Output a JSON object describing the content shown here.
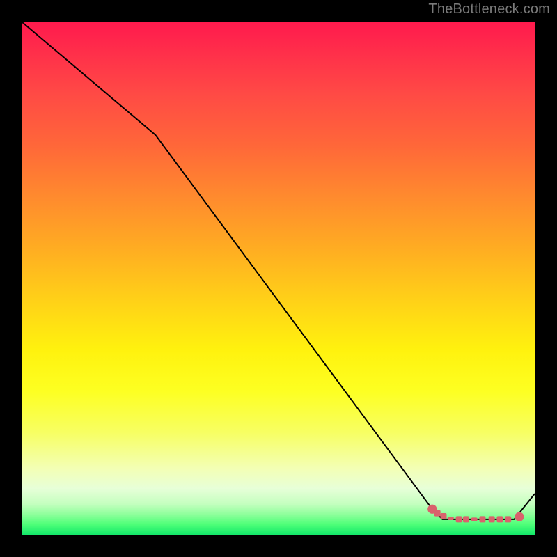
{
  "watermark": "TheBottleneck.com",
  "chart_data": {
    "type": "line",
    "title": "",
    "xlabel": "",
    "ylabel": "",
    "xlim": [
      0,
      100
    ],
    "ylim": [
      0,
      100
    ],
    "series": [
      {
        "name": "curve",
        "x": [
          0,
          26,
          80,
          82,
          90,
          96,
          100
        ],
        "y": [
          100,
          78,
          5,
          3,
          3,
          3,
          8
        ]
      }
    ],
    "markers": [
      {
        "shape": "circle",
        "x": 80.0,
        "y": 5.0,
        "r": 0.9
      },
      {
        "shape": "square",
        "x": 81.0,
        "y": 4.2
      },
      {
        "shape": "square",
        "x": 82.2,
        "y": 3.6
      },
      {
        "shape": "dash",
        "x": 83.6,
        "y": 3.2
      },
      {
        "shape": "square",
        "x": 85.2,
        "y": 3.0
      },
      {
        "shape": "square",
        "x": 86.6,
        "y": 3.0
      },
      {
        "shape": "dash",
        "x": 88.2,
        "y": 3.0
      },
      {
        "shape": "square",
        "x": 89.8,
        "y": 3.0
      },
      {
        "shape": "square",
        "x": 91.6,
        "y": 3.0
      },
      {
        "shape": "square",
        "x": 93.2,
        "y": 3.0
      },
      {
        "shape": "square",
        "x": 94.8,
        "y": 3.0
      },
      {
        "shape": "circle",
        "x": 97.0,
        "y": 3.5,
        "r": 0.9
      }
    ],
    "colors": {
      "line": "#000000",
      "marker": "#d9626c"
    }
  }
}
